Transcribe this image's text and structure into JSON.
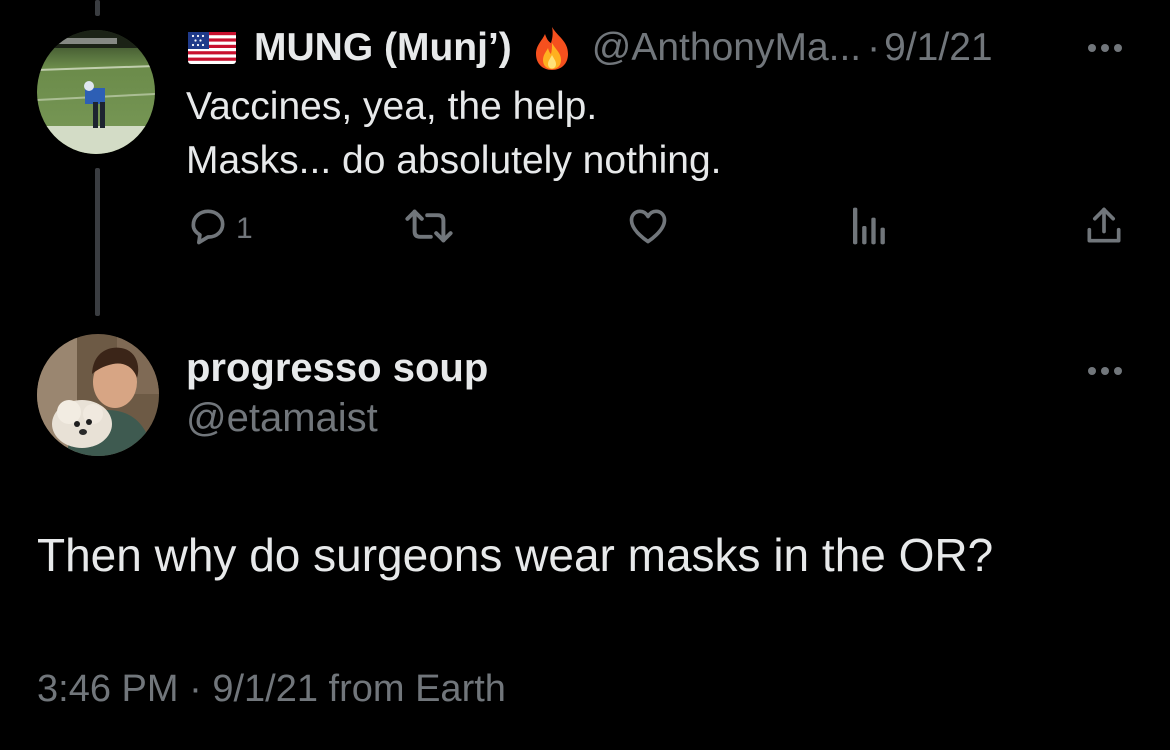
{
  "original_tweet": {
    "display_name": "MUNG (Munj’)",
    "handle": "@AnthonyMa...",
    "separator": "·",
    "date": "9/1/21",
    "text_lines": [
      "Vaccines, yea, the help.",
      "Masks... do absolutely nothing."
    ],
    "reply_count": "1",
    "icons": [
      "flag-us-icon",
      "fire-icon",
      "reply-icon",
      "retweet-icon",
      "like-icon",
      "analytics-icon",
      "share-icon",
      "more-icon"
    ]
  },
  "reply_tweet": {
    "display_name": "progresso soup",
    "handle": "@etamaist",
    "text": "Then why do surgeons wear masks in the OR?",
    "time": "3:46 PM",
    "separator": "·",
    "date": "9/1/21",
    "source": "from Earth"
  },
  "colors": {
    "background": "#000000",
    "primary_text": "#e7e9ea",
    "secondary_text": "#71767b"
  }
}
